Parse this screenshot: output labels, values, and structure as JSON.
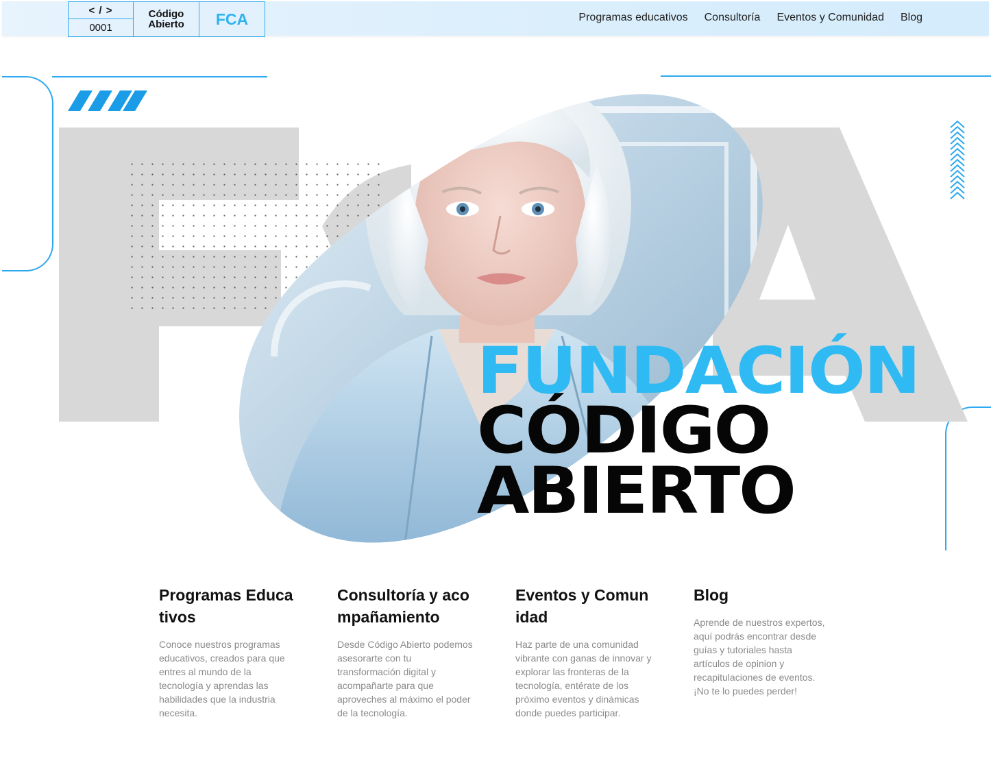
{
  "header": {
    "logo": {
      "code_tag": "< / >",
      "code_number": "0001",
      "name_line1": "Código",
      "name_line2": "Abierto",
      "acronym": "FCA"
    },
    "nav": [
      {
        "label": "Programas educativos"
      },
      {
        "label": "Consultoría"
      },
      {
        "label": "Eventos y Comunidad"
      },
      {
        "label": "Blog"
      }
    ]
  },
  "hero": {
    "background_letters": "FCA",
    "title_line1": "FUNDACIÓN",
    "title_line2": "CÓDIGO",
    "title_line3": "ABIERTO",
    "image_icon": "woman-portrait-image",
    "colors": {
      "accent": "#2fbaf3",
      "outline": "#2ea8ee",
      "big_letters": "#d8d8d8",
      "title": "#060606"
    }
  },
  "features": [
    {
      "title": "Programas Educativos",
      "text": "Conoce nuestros programas educativos, creados para que entres al mundo de la tecnología y aprendas las habilidades que la industria necesita."
    },
    {
      "title": "Consultoría y acompañamiento",
      "text": "Desde Código Abierto podemos asesorarte con tu transformación digital y acompañarte para que aproveches al máximo el poder de la tecnología."
    },
    {
      "title": "Eventos y Comunidad",
      "text": "Haz parte de una comunidad vibrante con ganas de innovar y explorar las fronteras de la tecnología, entérate de los próximo eventos y dinámicas donde puedes participar."
    },
    {
      "title": "Blog",
      "text": "Aprende de nuestros expertos, aquí podrás encontrar desde guías y tutoriales hasta artículos de opinion y recapitulaciones de eventos. ¡No te lo puedes perder!"
    }
  ]
}
